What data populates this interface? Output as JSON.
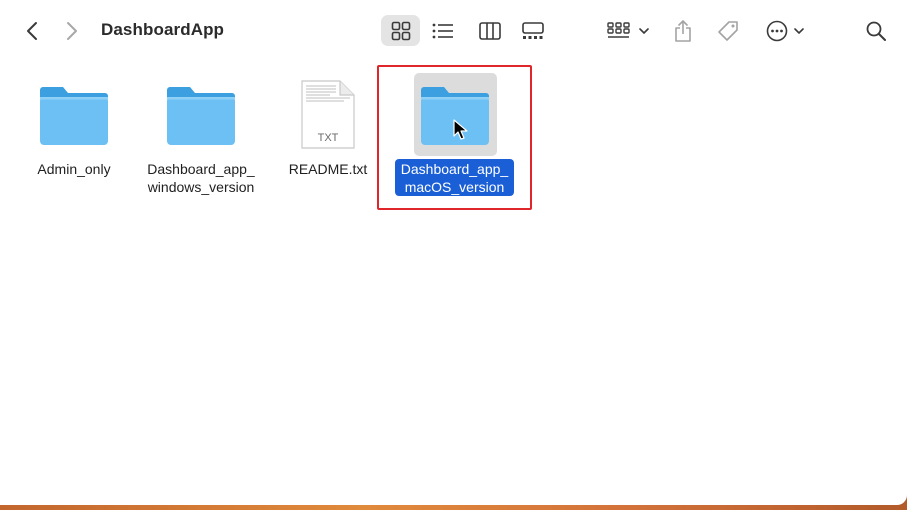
{
  "window": {
    "title": "DashboardApp"
  },
  "toolbar": {
    "icons": [
      "back-icon",
      "forward-icon",
      "icon-view-icon",
      "list-view-icon",
      "column-view-icon",
      "gallery-view-icon",
      "group-icon",
      "share-icon",
      "tag-icon",
      "more-icon",
      "search-icon"
    ]
  },
  "files": [
    {
      "name_line1": "Admin_only",
      "name_line2": "",
      "type": "folder",
      "selected": false
    },
    {
      "name_line1": "Dashboard_app_",
      "name_line2": "windows_version",
      "type": "folder",
      "selected": false
    },
    {
      "name_line1": "README.txt",
      "name_line2": "",
      "type": "text-file",
      "file_ext": "TXT",
      "selected": false
    },
    {
      "name_line1": "Dashboard_app_",
      "name_line2": "macOS_version",
      "type": "folder",
      "selected": true
    }
  ],
  "colors": {
    "folder_light": "#6cc0f4",
    "folder_dark": "#3b9fe0",
    "selection": "#1a5fd6",
    "highlight_border": "#e0262a"
  }
}
